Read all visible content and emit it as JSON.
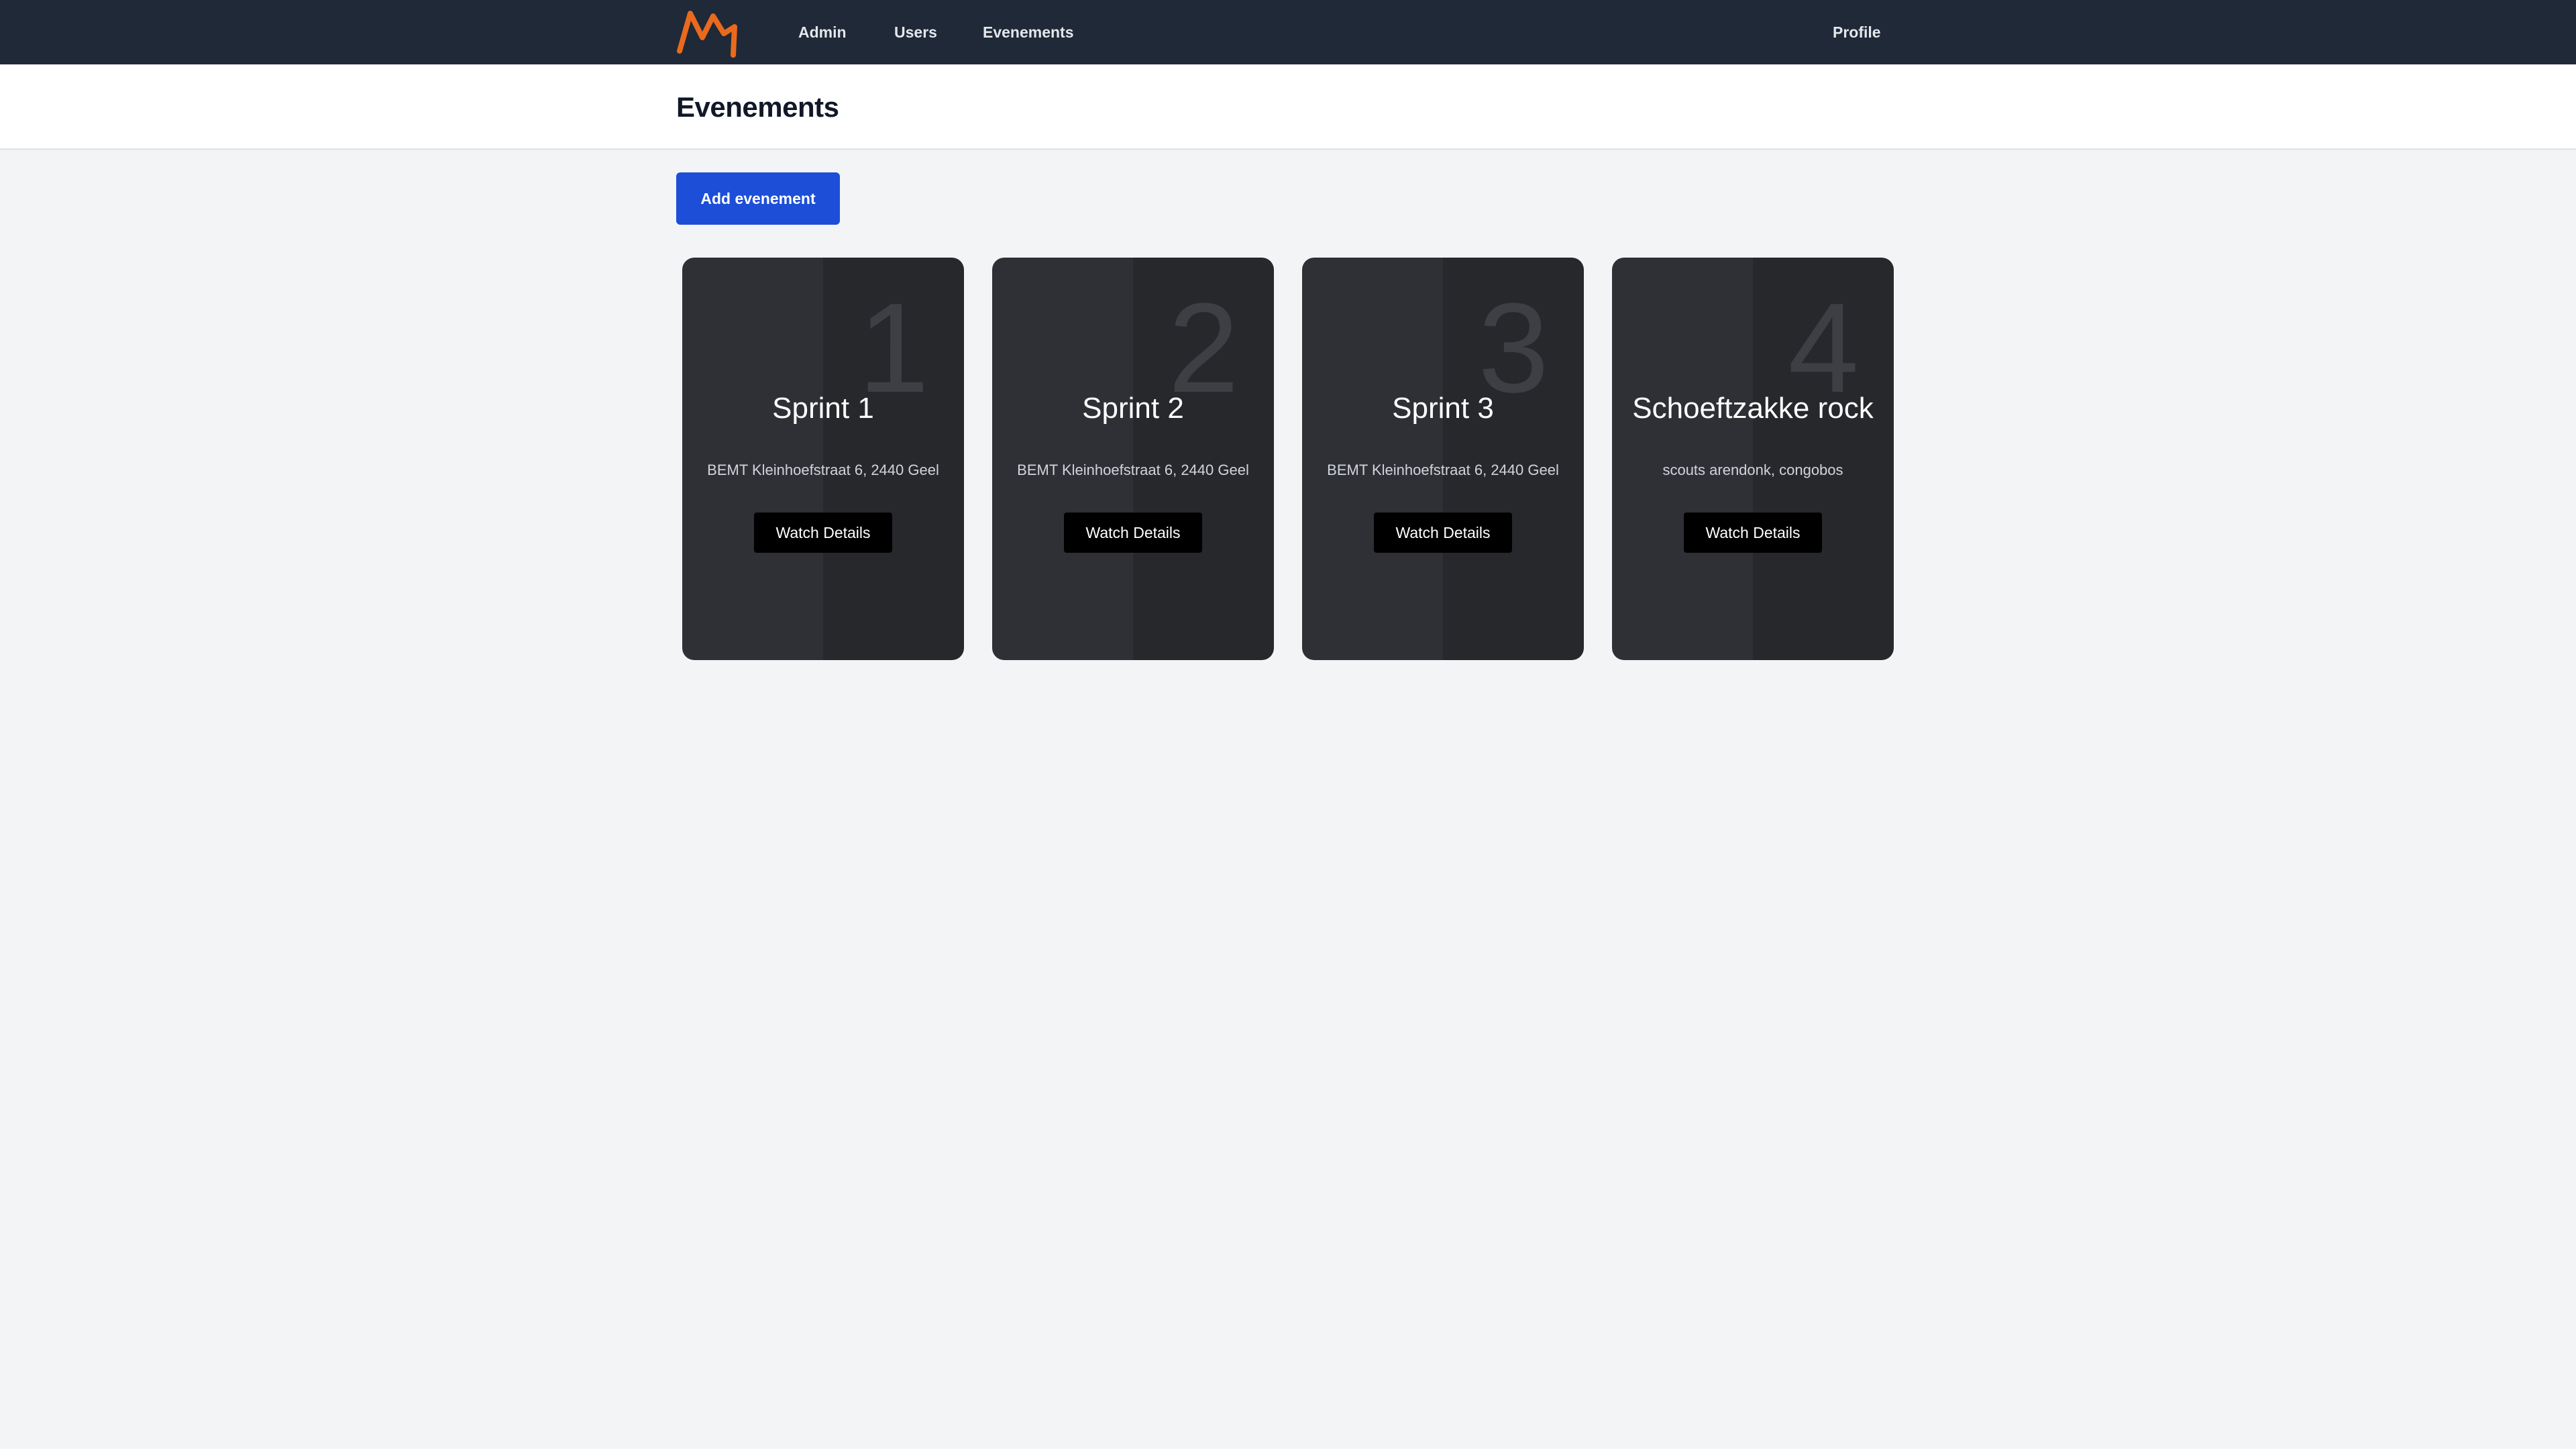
{
  "nav": {
    "logo_color": "#ea6a1d",
    "items": [
      {
        "label": "Admin"
      },
      {
        "label": "Users"
      },
      {
        "label": "Evenements"
      }
    ],
    "profile_label": "Profile"
  },
  "header": {
    "title": "Evenements"
  },
  "actions": {
    "add_label": "Add evenement"
  },
  "cards": [
    {
      "number": "1",
      "title": "Sprint 1",
      "location": "BEMT Kleinhoefstraat 6, 2440 Geel",
      "button": "Watch Details"
    },
    {
      "number": "2",
      "title": "Sprint 2",
      "location": "BEMT Kleinhoefstraat 6, 2440 Geel",
      "button": "Watch Details"
    },
    {
      "number": "3",
      "title": "Sprint 3",
      "location": "BEMT Kleinhoefstraat 6, 2440 Geel",
      "button": "Watch Details"
    },
    {
      "number": "4",
      "title": "Schoeftzakke rock",
      "location": "scouts arendonk, congobos",
      "button": "Watch Details"
    }
  ],
  "colors": {
    "navbar_bg": "#1f2937",
    "primary_button": "#1d4ed8",
    "page_bg": "#f3f4f6",
    "card_bg": "#2f3035"
  }
}
